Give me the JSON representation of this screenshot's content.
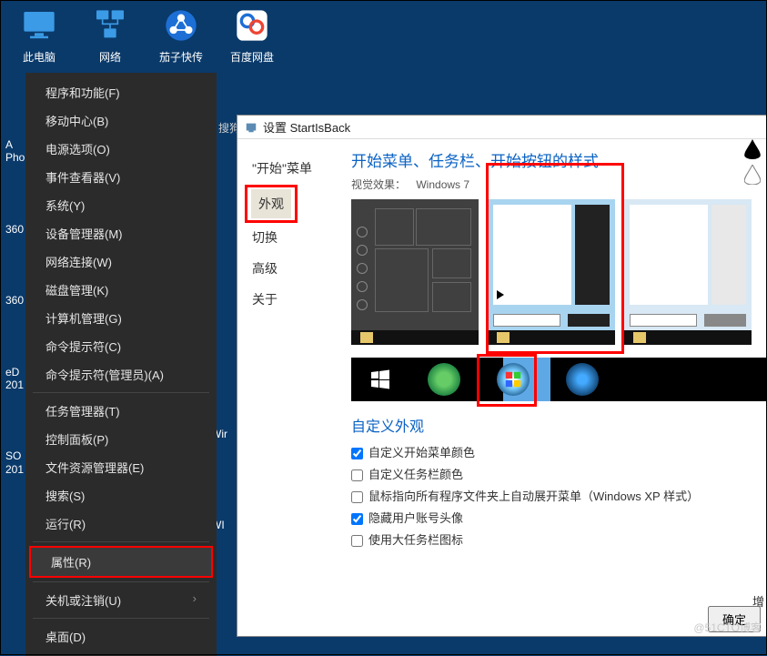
{
  "desktop": {
    "items": [
      {
        "label": "此电脑",
        "icon": "pc-icon"
      },
      {
        "label": "网络",
        "icon": "network-icon"
      },
      {
        "label": "茄子快传",
        "icon": "shareit-icon"
      },
      {
        "label": "百度网盘",
        "icon": "baidu-icon"
      }
    ]
  },
  "left_fragments": [
    "A\nPho",
    "360",
    "360",
    "eD\n201",
    "SO\n201"
  ],
  "bg_fragments": [
    "搜狗",
    "Wir",
    "WI"
  ],
  "context_menu": {
    "items": [
      "程序和功能(F)",
      "移动中心(B)",
      "电源选项(O)",
      "事件查看器(V)",
      "系统(Y)",
      "设备管理器(M)",
      "网络连接(W)",
      "磁盘管理(K)",
      "计算机管理(G)",
      "命令提示符(C)",
      "命令提示符(管理员)(A)",
      "任务管理器(T)",
      "控制面板(P)",
      "文件资源管理器(E)",
      "搜索(S)",
      "运行(R)",
      "属性(R)",
      "关机或注销(U)",
      "桌面(D)"
    ],
    "sep_after": [
      10,
      15,
      16,
      17
    ],
    "submenu_at": 17,
    "highlighted_index": 16
  },
  "window": {
    "title": "设置 StartIsBack",
    "sidebar": {
      "items": [
        "\"开始\"菜单",
        "外观",
        "切换",
        "高级",
        "关于"
      ],
      "selected_index": 1,
      "highlight_index": 1
    },
    "heading": "开始菜单、任务栏、开始按钮的样式",
    "subheading_label": "视觉效果：",
    "subheading_value": "Windows 7",
    "section2": "自定义外观",
    "checks": [
      {
        "label": "自定义开始菜单颜色",
        "checked": true
      },
      {
        "label": "自定义任务栏颜色",
        "checked": false
      },
      {
        "label": "鼠标指向所有程序文件夹上自动展开菜单（Windows XP 样式）",
        "checked": false
      },
      {
        "label": "隐藏用户账号头像",
        "checked": true
      },
      {
        "label": "使用大任务栏图标",
        "checked": false
      }
    ],
    "right_cut_label": "增",
    "ok_button": "确定"
  },
  "watermark": "@51CTO博客"
}
